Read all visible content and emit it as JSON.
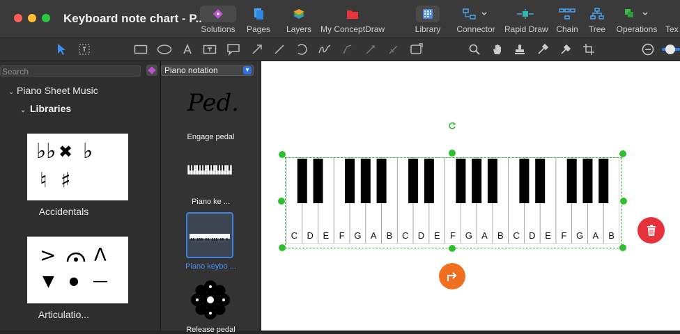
{
  "window": {
    "title": "Keyboard note chart - P..."
  },
  "toolbar": {
    "items": [
      {
        "label": "Solutions",
        "icon": "solutions-icon"
      },
      {
        "label": "Pages",
        "icon": "pages-icon"
      },
      {
        "label": "Layers",
        "icon": "layers-icon"
      },
      {
        "label": "My ConceptDraw",
        "icon": "my-conceptdraw-icon"
      },
      {
        "label": "Library",
        "icon": "library-icon"
      },
      {
        "label": "Connector",
        "icon": "connector-icon"
      },
      {
        "label": "Rapid Draw",
        "icon": "rapid-draw-icon"
      },
      {
        "label": "Chain",
        "icon": "chain-icon"
      },
      {
        "label": "Tree",
        "icon": "tree-icon"
      },
      {
        "label": "Operations",
        "icon": "operations-icon"
      },
      {
        "label": "Tex",
        "icon": "text-icon"
      }
    ]
  },
  "left_panel": {
    "search_placeholder": "Search",
    "tree": {
      "root": "Piano Sheet Music",
      "child": "Libraries"
    },
    "libraries": [
      {
        "label": "Accidentals",
        "glyphs": [
          "♭♭",
          "✖",
          "♭",
          "♮",
          "♯"
        ]
      },
      {
        "label": "Articulatio...",
        "glyphs": [
          ">",
          "𝄐",
          "Λ",
          "▼",
          "●",
          "—"
        ]
      }
    ]
  },
  "library_panel": {
    "selected_library": "Piano notation",
    "items": [
      {
        "label": "Engage pedal",
        "glyph": "Ped."
      },
      {
        "label": "Piano ke ..."
      },
      {
        "label": "Piano keybo ...",
        "selected": true
      },
      {
        "label": "Release pedal"
      }
    ]
  },
  "canvas": {
    "keyboard_notes": [
      "C",
      "D",
      "E",
      "F",
      "G",
      "A",
      "B",
      "C",
      "D",
      "E",
      "F",
      "G",
      "A",
      "B",
      "C",
      "D",
      "E",
      "F",
      "G",
      "A",
      "B"
    ],
    "colors": {
      "selection": "#2ec02e",
      "delete_button": "#e8323b",
      "connector_button": "#f07020"
    }
  }
}
